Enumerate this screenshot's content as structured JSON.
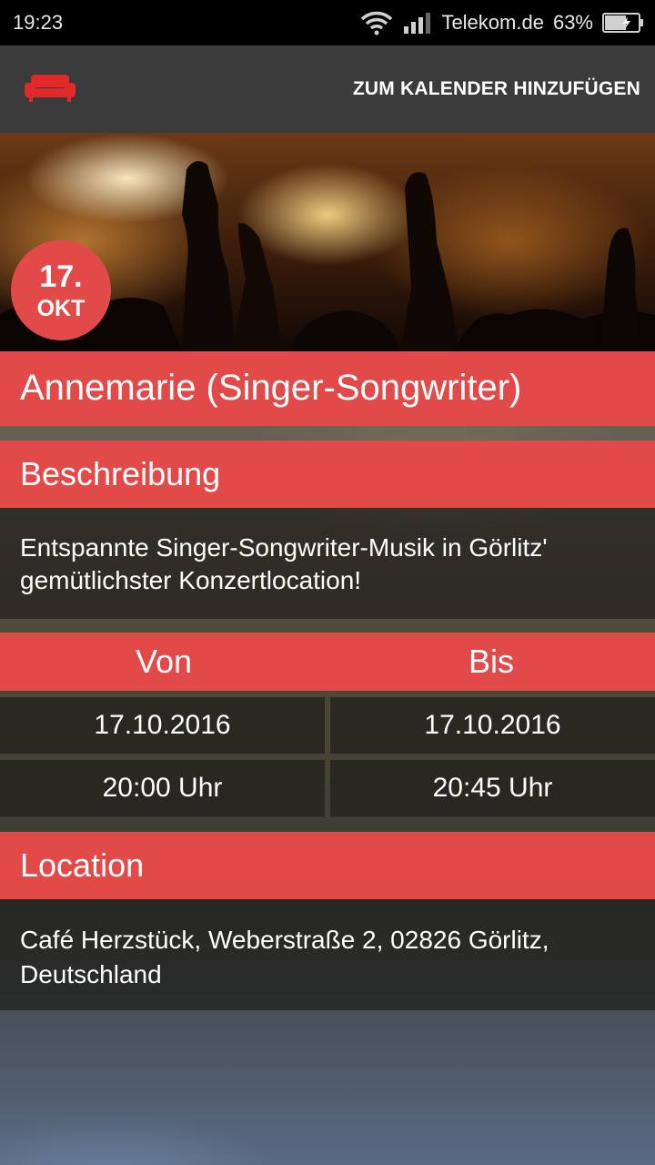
{
  "status_bar": {
    "time": "19:23",
    "carrier": "Telekom.de",
    "battery": "63%"
  },
  "toolbar": {
    "action_label": "ZUM KALENDER HINZUFÜGEN"
  },
  "event": {
    "date_day": "17.",
    "date_month": "OKT",
    "title": "Annemarie (Singer-Songwriter)"
  },
  "description": {
    "header": "Beschreibung",
    "text": "Entspannte Singer-Songwriter-Musik in Görlitz' gemütlichster Konzertlocation!"
  },
  "schedule": {
    "from_label": "Von",
    "to_label": "Bis",
    "from_date": "17.10.2016",
    "to_date": "17.10.2016",
    "from_time": "20:00 Uhr",
    "to_time": "20:45 Uhr"
  },
  "location": {
    "header": "Location",
    "address": "Café Herzstück, Weberstraße 2, 02826 Görlitz, Deutschland"
  },
  "colors": {
    "accent": "#e24a4a",
    "toolbar": "#3c3b3b"
  },
  "icons": {
    "app": "sofa-icon",
    "wifi": "wifi-icon",
    "signal": "signal-icon",
    "battery": "battery-icon"
  }
}
